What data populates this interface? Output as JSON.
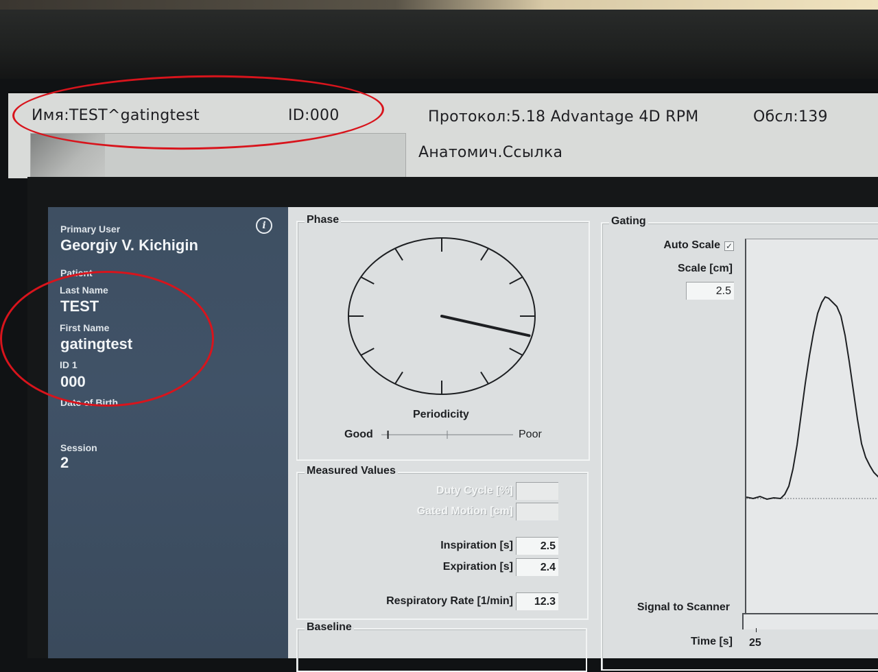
{
  "top_screen": {
    "name_label": "Имя:TEST^gatingtest",
    "id_label": "ID:000",
    "protocol_label": "Протокол:5.18 Advantage 4D RPM",
    "exam_label": "Обсл:139",
    "anatomy_label": "Анатомич.Ссылка"
  },
  "patient_panel": {
    "primary_user_label": "Primary User",
    "primary_user_value": "Georgiy V. Kichigin",
    "patient_label": "Patient",
    "last_name_label": "Last Name",
    "last_name_value": "TEST",
    "first_name_label": "First Name",
    "first_name_value": "gatingtest",
    "id1_label": "ID 1",
    "id1_value": "000",
    "dob_label": "Date of Birth",
    "session_label": "Session",
    "session_value": "2",
    "info_icon": "info-icon"
  },
  "phase": {
    "title": "Phase",
    "periodicity_label": "Periodicity",
    "good_label": "Good",
    "poor_label": "Poor",
    "periodicity_level": 0.05,
    "clock_hand_angle_deg": 105
  },
  "measured_values": {
    "title": "Measured Values",
    "duty_cycle_label": "Duty Cycle [%]",
    "duty_cycle_value": "",
    "gated_motion_label": "Gated Motion [cm]",
    "gated_motion_value": "",
    "inspiration_label": "Inspiration [s]",
    "inspiration_value": "2.5",
    "expiration_label": "Expiration [s]",
    "expiration_value": "2.4",
    "resp_rate_label": "Respiratory Rate [1/min]",
    "resp_rate_value": "12.3"
  },
  "baseline": {
    "title": "Baseline"
  },
  "gating": {
    "title": "Gating",
    "auto_scale_label": "Auto Scale",
    "auto_scale_checked": true,
    "scale_label": "Scale [cm]",
    "scale_value": "2.5",
    "signal_label": "Signal to Scanner",
    "time_label": "Time [s]",
    "time_tick": "25"
  },
  "colors": {
    "annotation_red": "#d8141c",
    "panel_blue": "#3e4f62",
    "content_gray": "#dcdfe0"
  }
}
